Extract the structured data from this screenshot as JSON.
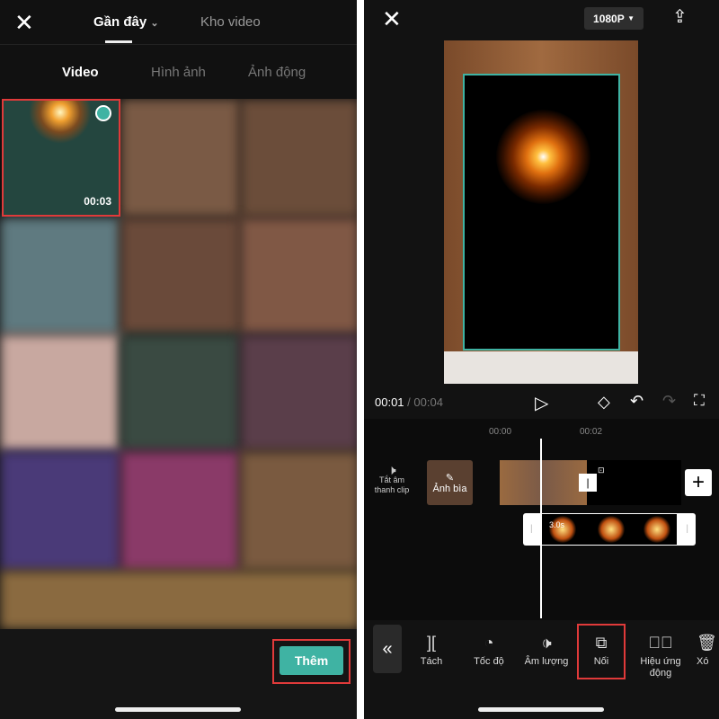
{
  "left": {
    "close_icon": "close-icon",
    "tabs": [
      {
        "label": "Gần đây",
        "active": true
      },
      {
        "label": "Kho video",
        "active": false
      }
    ],
    "subtabs": [
      {
        "label": "Video",
        "active": true
      },
      {
        "label": "Hình ảnh",
        "active": false
      },
      {
        "label": "Ảnh động",
        "active": false
      }
    ],
    "selected_item": {
      "duration": "00:03"
    },
    "add_button": "Thêm",
    "accent": "#3fb3a3",
    "highlight": "#e03a3a"
  },
  "right": {
    "resolution": "1080P",
    "time_current": "00:01",
    "time_total": "/ 00:04",
    "ruler": [
      "00:00",
      "00:02"
    ],
    "mute_label": "Tắt âm thanh clip",
    "cover_label": "Ảnh bìa",
    "overlay_duration": "3.0s",
    "tools": [
      {
        "label": "Tách",
        "icon": "split-icon"
      },
      {
        "label": "Tốc độ",
        "icon": "speed-icon"
      },
      {
        "label": "Âm lượng",
        "icon": "volume-icon"
      },
      {
        "label": "Nối",
        "icon": "overlay-icon",
        "highlighted": true
      },
      {
        "label": "Hiệu ứng động",
        "icon": "animation-icon"
      },
      {
        "label": "Xó",
        "icon": "delete-icon"
      }
    ]
  }
}
